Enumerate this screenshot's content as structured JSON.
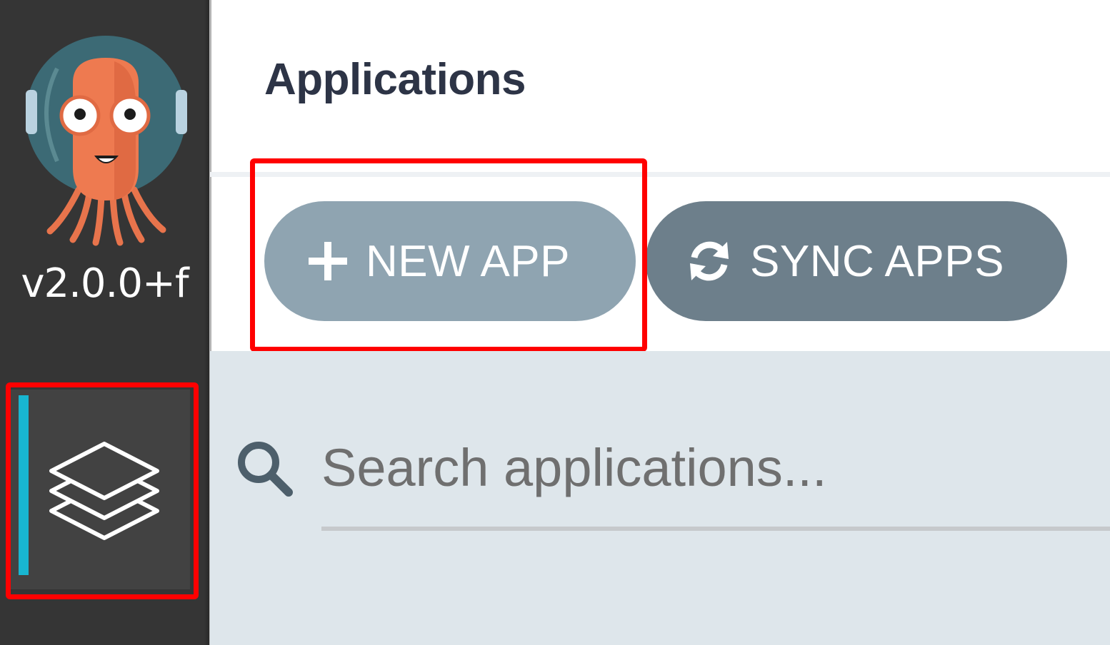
{
  "sidebar": {
    "logo": "argo-octopus-logo",
    "version": "v2.0.0+f",
    "nav_items": [
      {
        "name": "applications",
        "icon": "layers-icon",
        "active": true
      }
    ]
  },
  "header": {
    "title": "Applications"
  },
  "toolbar": {
    "new_app_label": "NEW APP",
    "new_app_icon": "plus-icon",
    "sync_apps_label": "SYNC APPS",
    "sync_apps_icon": "sync-icon"
  },
  "search": {
    "placeholder": "Search applications...",
    "value": ""
  },
  "colors": {
    "sidebar_bg": "#353535",
    "nav_active_accent": "#18b6d1",
    "new_app_button": "#8fa4b1",
    "sync_apps_button": "#6d7f8b",
    "highlight": "#ff0000",
    "search_area_bg": "#dee6eb"
  }
}
